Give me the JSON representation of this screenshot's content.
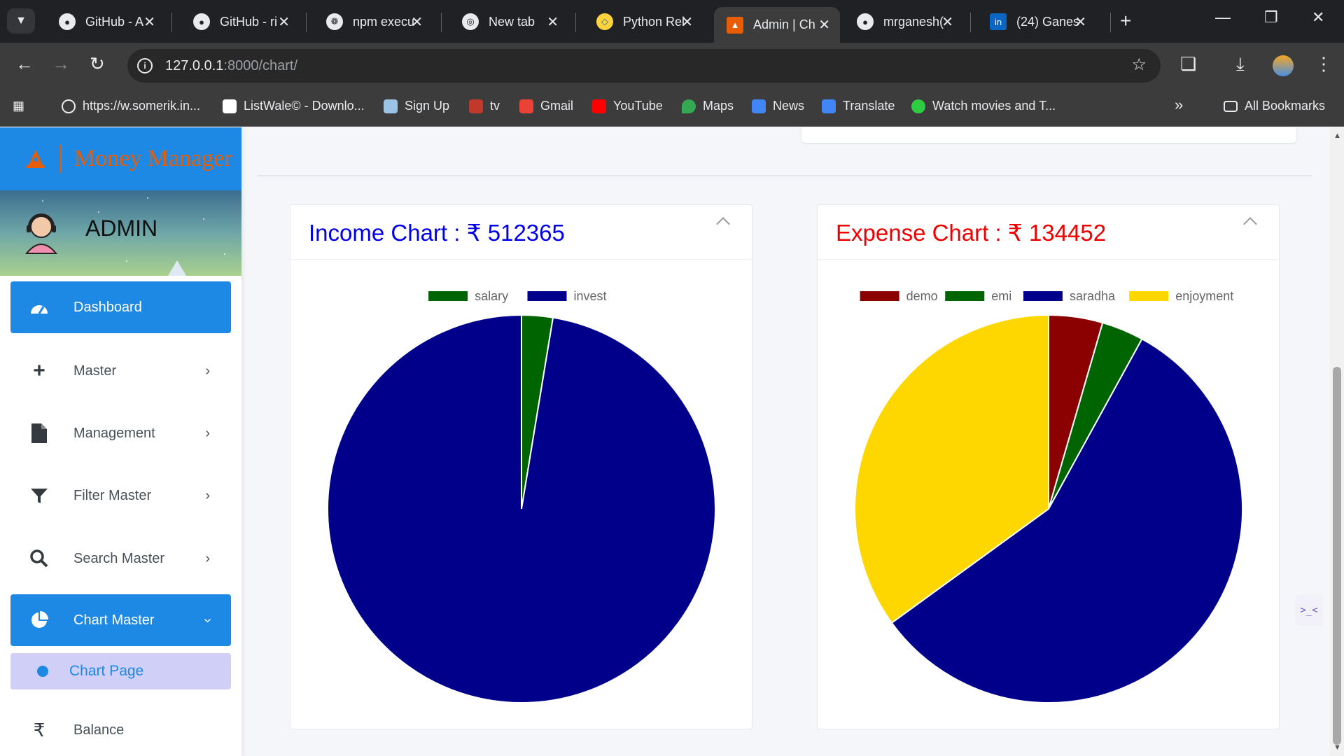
{
  "browser": {
    "tabs": [
      {
        "title": "GitHub - A",
        "icon": "github-icon"
      },
      {
        "title": "GitHub - ri",
        "icon": "github-icon"
      },
      {
        "title": "npm execu",
        "icon": "openai-icon"
      },
      {
        "title": "New tab",
        "icon": "chrome-icon"
      },
      {
        "title": "Python Rel",
        "icon": "python-icon"
      },
      {
        "title": "Admin | Ch",
        "icon": "app-logo-icon",
        "active": true
      },
      {
        "title": "mrganesh(",
        "icon": "github-icon"
      },
      {
        "title": "(24) Ganes",
        "icon": "linkedin-icon"
      }
    ],
    "url_host": "127.0.0.1",
    "url_path": ":8000/chart/",
    "bookmarks": [
      {
        "label": "https://w.somerik.in...",
        "icon": "globe-icon",
        "color": "#e8eaed"
      },
      {
        "label": "ListWale© - Downlo...",
        "icon": "page-icon",
        "color": "#ffffff"
      },
      {
        "label": "Sign Up",
        "icon": "signup-icon",
        "color": "#9cc3e6"
      },
      {
        "label": "tv",
        "icon": "tv-icon",
        "color": "#c0392b"
      },
      {
        "label": "Gmail",
        "icon": "gmail-icon",
        "color": "#ea4335"
      },
      {
        "label": "YouTube",
        "icon": "youtube-icon",
        "color": "#ff0000"
      },
      {
        "label": "Maps",
        "icon": "maps-icon",
        "color": "#34a853"
      },
      {
        "label": "News",
        "icon": "news-icon",
        "color": "#4285f4"
      },
      {
        "label": "Translate",
        "icon": "translate-icon",
        "color": "#4285f4"
      },
      {
        "label": "Watch movies and T...",
        "icon": "play-icon",
        "color": "#2ecc40"
      }
    ],
    "all_bookmarks": "All Bookmarks",
    "overflow": "»"
  },
  "app": {
    "brand_name": "Money Manager",
    "user_name": "ADMIN",
    "accent": "#1e88e5",
    "brand_color": "#e85d04"
  },
  "nav": {
    "dashboard": "Dashboard",
    "master": "Master",
    "management": "Management",
    "filter_master": "Filter Master",
    "search_master": "Search Master",
    "chart_master": "Chart Master",
    "chart_page": "Chart Page",
    "balance": "Balance"
  },
  "cards": {
    "income": {
      "title": "Income Chart : ₹ 512365",
      "color": "#0000ee"
    },
    "expense": {
      "title": "Expense Chart : ₹ 134452",
      "color": "#ee0000"
    }
  },
  "chart_data": [
    {
      "type": "pie",
      "title": "Income Chart : ₹ 512365",
      "categories": [
        "salary",
        "invest"
      ],
      "values": [
        2.6,
        97.4
      ],
      "colors": [
        "#006400",
        "#00008b"
      ],
      "legend": "top"
    },
    {
      "type": "pie",
      "title": "Expense Chart : ₹ 134452",
      "categories": [
        "demo",
        "emi",
        "saradha",
        "enjoyment"
      ],
      "values": [
        4.5,
        3.5,
        57.0,
        35.0
      ],
      "colors": [
        "#8b0000",
        "#006400",
        "#00008b",
        "#ffd700"
      ],
      "legend": "top"
    }
  ]
}
